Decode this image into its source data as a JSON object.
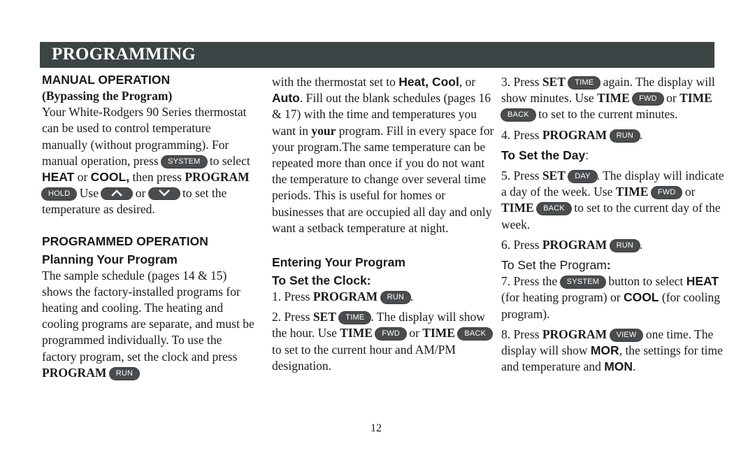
{
  "header": {
    "title": "PROGRAMMING",
    "bar_color": "#3c4446"
  },
  "buttons": {
    "system": "SYSTEM",
    "hold": "HOLD",
    "run": "RUN",
    "time": "TIME",
    "fwd": "FWD",
    "back": "BACK",
    "day": "DAY",
    "view": "VIEW",
    "up_arrow_icon": "chevron-up",
    "down_arrow_icon": "chevron-down",
    "pill_color": "#4a4d4f"
  },
  "col1": {
    "manual_heading": "MANUAL OPERATION",
    "manual_subheading": "(Bypassing the Program)",
    "manual_text_1": "Your White-Rodgers 90 Series thermostat can be used to control temperature manually (without programming). For manual operation, press",
    "manual_text_2": "to select",
    "heat": "HEAT",
    "or": "or",
    "cool": "COOL,",
    "then_press": "then press",
    "program": "PROGRAM",
    "use": "Use",
    "or2": "or",
    "to_set": "to set the temperature as desired.",
    "programmed_heading": "PROGRAMMED OPERATION",
    "planning_heading": "Planning Your Program",
    "planning_text": "The sample schedule (pages 14 & 15) shows the factory-installed programs for heating and cooling. The heating and cooling programs are separate, and must be programmed individually. To use the factory program, set the clock and press",
    "planning_program": "PROGRAM"
  },
  "col2": {
    "text_a": "with the thermostat set to",
    "heat_cool": "Heat, Cool",
    "comma_or": ", or",
    "auto": "Auto",
    "text_b": ". Fill out the blank schedules (pages 16 & 17) with the time and temperatures you want in",
    "your": "your",
    "text_c": "program. Fill in every space for your program.The same temperature can be repeated more than once if you do not want the temperature to change over several time periods. This is useful for homes or businesses that are occupied all day and only want a setback temperature at night.",
    "entering_heading": "Entering Your Program",
    "clock_heading": "To Set the Clock:",
    "step1_prefix": "1.  Press",
    "step1_program": "PROGRAM",
    "step1_suffix": ".",
    "step2_prefix": "2.  Press",
    "step2_set": "SET",
    "step2_text": ". The display will show the hour. Use",
    "step2_time1": "TIME",
    "step2_or": "or",
    "step2_time2": "TIME",
    "step2_suffix": "to set to the current hour and AM/PM designation."
  },
  "col3": {
    "step3_prefix": "3.  Press",
    "step3_set": "SET",
    "step3_text": "again. The display will show minutes. Use",
    "step3_time1": "TIME",
    "step3_or": "or",
    "step3_time2": "TIME",
    "step3_suffix": "to set to the current minutes.",
    "step4_prefix": "4.  Press",
    "step4_program": "PROGRAM",
    "step4_suffix": ".",
    "day_heading": "To Set the Day",
    "day_colon": ":",
    "step5_prefix": "5.  Press",
    "step5_set": "SET",
    "step5_text": ". The display will indicate a day of the week. Use",
    "step5_time1": "TIME",
    "step5_or": "or",
    "step5_time2": "TIME",
    "step5_suffix": "to set to the current day of the week.",
    "step6_prefix": "6.  Press",
    "step6_program": "PROGRAM",
    "step6_suffix": ".",
    "program_heading": "To Set the Program",
    "program_colon": ":",
    "step7_prefix": "7.  Press the",
    "step7_text": "button to select",
    "step7_heat": "HEAT",
    "step7_mid": "(for heating program) or",
    "step7_cool": "COOL",
    "step7_suffix": "(for cooling program).",
    "step8_prefix": "8.  Press",
    "step8_program": "PROGRAM",
    "step8_text": "one time. The display will show",
    "step8_mor": "MOR",
    "step8_mid": ", the settings for time and temperature and",
    "step8_mon": "MON",
    "step8_suffix": "."
  },
  "footer": {
    "page_number": "12"
  }
}
